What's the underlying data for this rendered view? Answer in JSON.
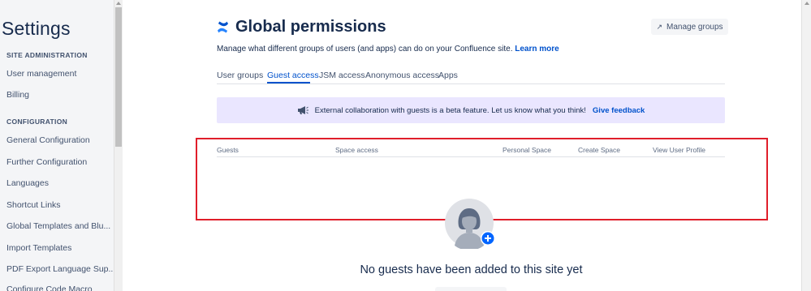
{
  "sidebar": {
    "title": "Settings",
    "sections": [
      {
        "heading": "SITE ADMINISTRATION",
        "items": [
          "User management",
          "Billing"
        ]
      },
      {
        "heading": "CONFIGURATION",
        "items": [
          "General Configuration",
          "Further Configuration",
          "Languages",
          "Shortcut Links",
          "Global Templates and Blu...",
          "Import Templates",
          "PDF Export Language Sup...",
          "Configure Code Macro"
        ]
      }
    ]
  },
  "header": {
    "title": "Global permissions",
    "manage_groups": "Manage groups",
    "subtitle": "Manage what different groups of users (and apps) can do on your Confluence site.",
    "learn_more": "Learn more"
  },
  "tabs": [
    {
      "label": "User groups",
      "active": false
    },
    {
      "label": "Guest access",
      "active": true
    },
    {
      "label": "JSM access",
      "active": false
    },
    {
      "label": "Anonymous access",
      "active": false
    },
    {
      "label": "Apps",
      "active": false
    }
  ],
  "banner": {
    "icon": "megaphone-icon",
    "text": "External collaboration with guests is a beta feature. Let us know what you think!",
    "feedback": "Give feedback"
  },
  "table": {
    "columns": [
      "Guests",
      "Space access",
      "Personal Space",
      "Create Space",
      "View User Profile"
    ]
  },
  "empty_state": {
    "message": "No guests have been added to this site yet"
  },
  "colors": {
    "accent": "#0052cc",
    "banner_bg": "#eae6ff",
    "annotation": "#e01e2a",
    "sidebar_bg": "#f4f5f7"
  }
}
